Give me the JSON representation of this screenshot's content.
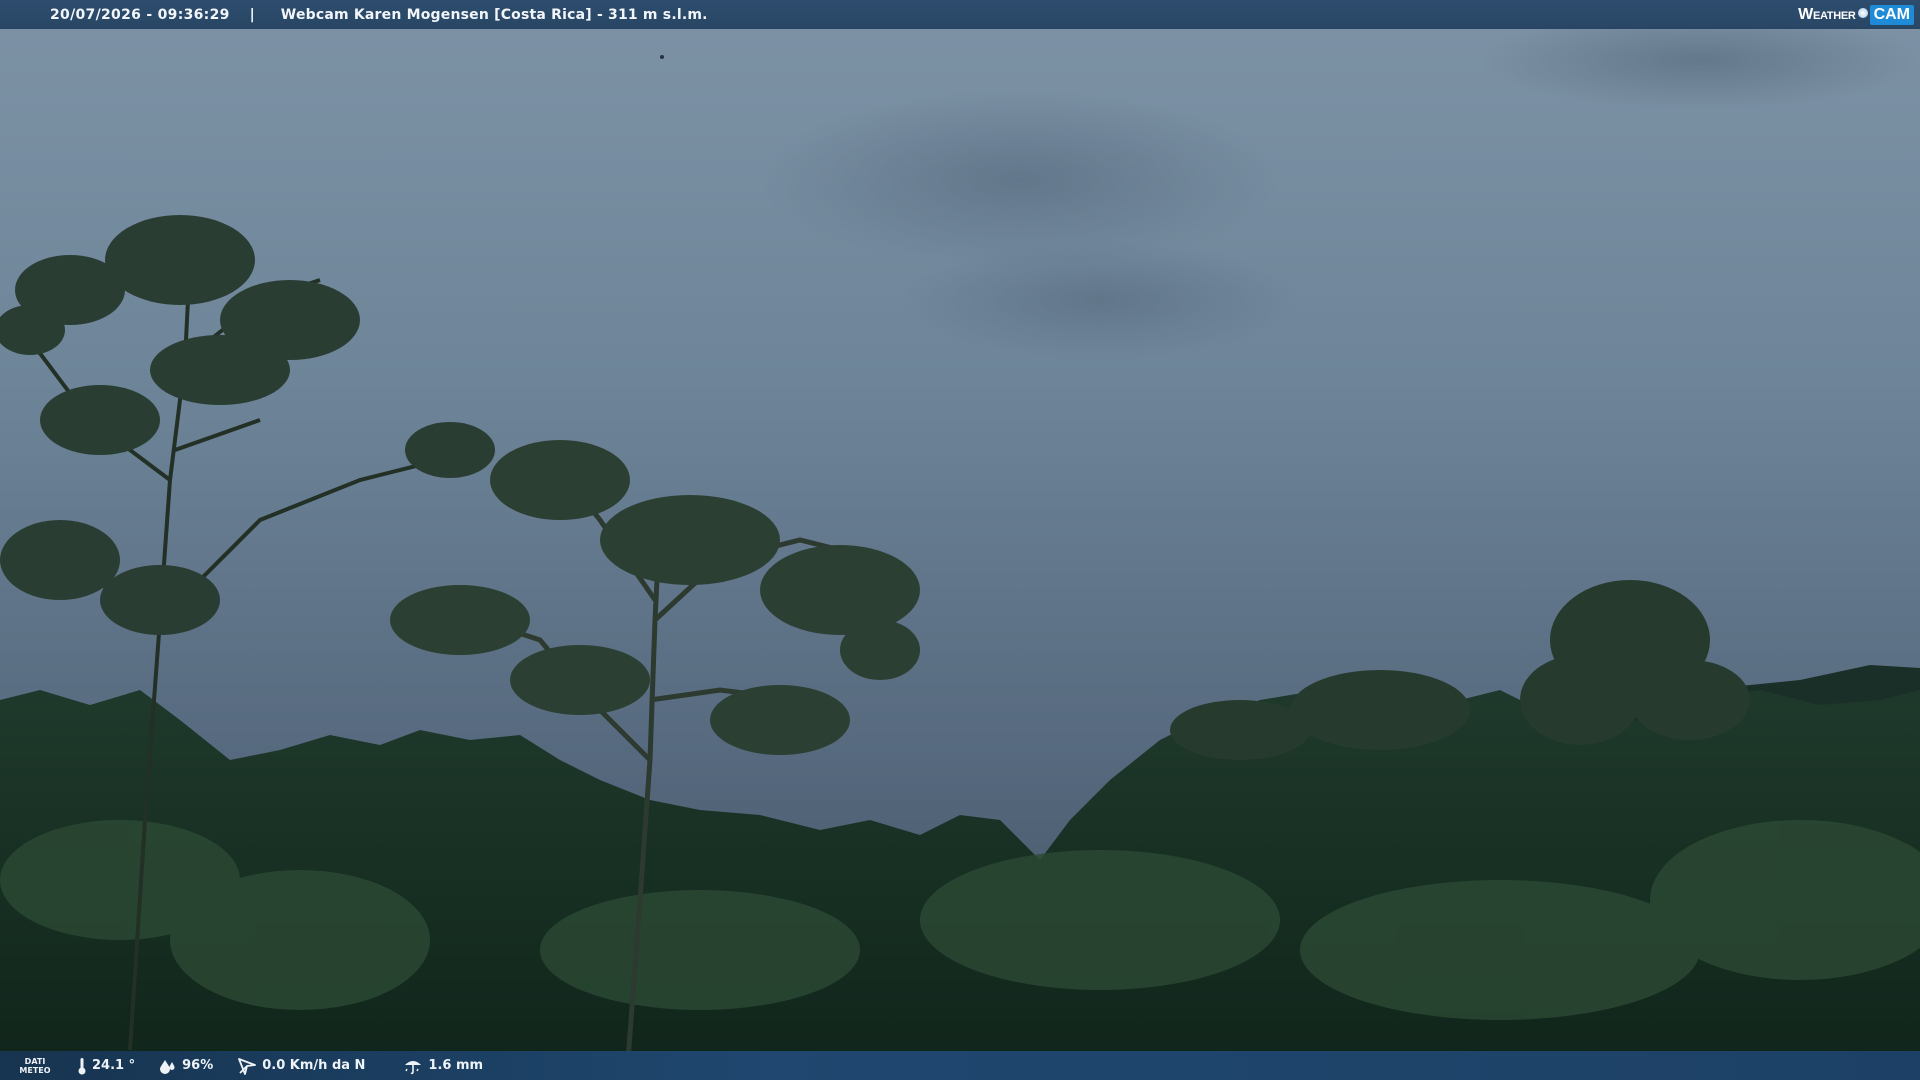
{
  "header": {
    "timestamp": "20/07/2026 - 09:36:29",
    "separator": "|",
    "title": "Webcam Karen Mogensen [Costa Rica]  - 311 m s.l.m.",
    "logo_weather": "Weather",
    "logo_cam": "CAM"
  },
  "footer": {
    "dati_meteo": "DATI METEO",
    "temperature": "24.1 °",
    "humidity": "96%",
    "wind": "0.0 Km/h da N",
    "rain": "1.6 mm"
  },
  "icons": [
    "thermometer-icon",
    "humidity-icon",
    "wind-icon",
    "rain-icon"
  ],
  "colors": {
    "bar_top": "#2e4d6e",
    "bar_bottom": "#1f476f",
    "logo_accent": "#1f8bd6"
  }
}
